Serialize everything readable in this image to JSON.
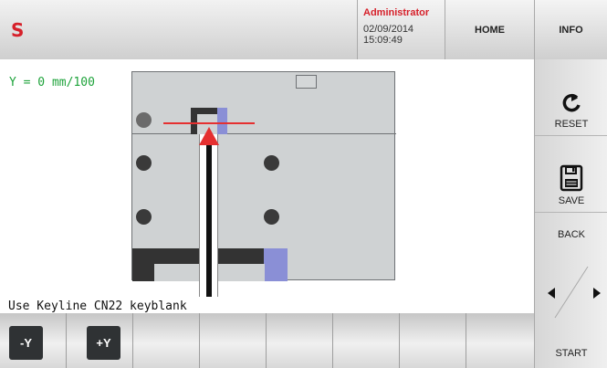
{
  "header": {
    "logo": "S",
    "user": "Administrator",
    "date": "02/09/2014",
    "time": "15:09:49",
    "home_label": "HOME",
    "info_label": "INFO"
  },
  "readout": {
    "y_text": "Y = 0 mm/100"
  },
  "instruction": "Use Keyline CN22 keyblank",
  "right_panel": {
    "reset_label": "RESET",
    "save_label": "SAVE",
    "back_label": "BACK",
    "start_label": "START"
  },
  "bottom_bar": {
    "minus_y_label": "-Y",
    "plus_y_label": "+Y"
  },
  "colors": {
    "brand_red": "#d6202a",
    "readout_green": "#1ea33b",
    "marker_red": "#e53030",
    "highlight_blue": "#8a8fd6"
  }
}
